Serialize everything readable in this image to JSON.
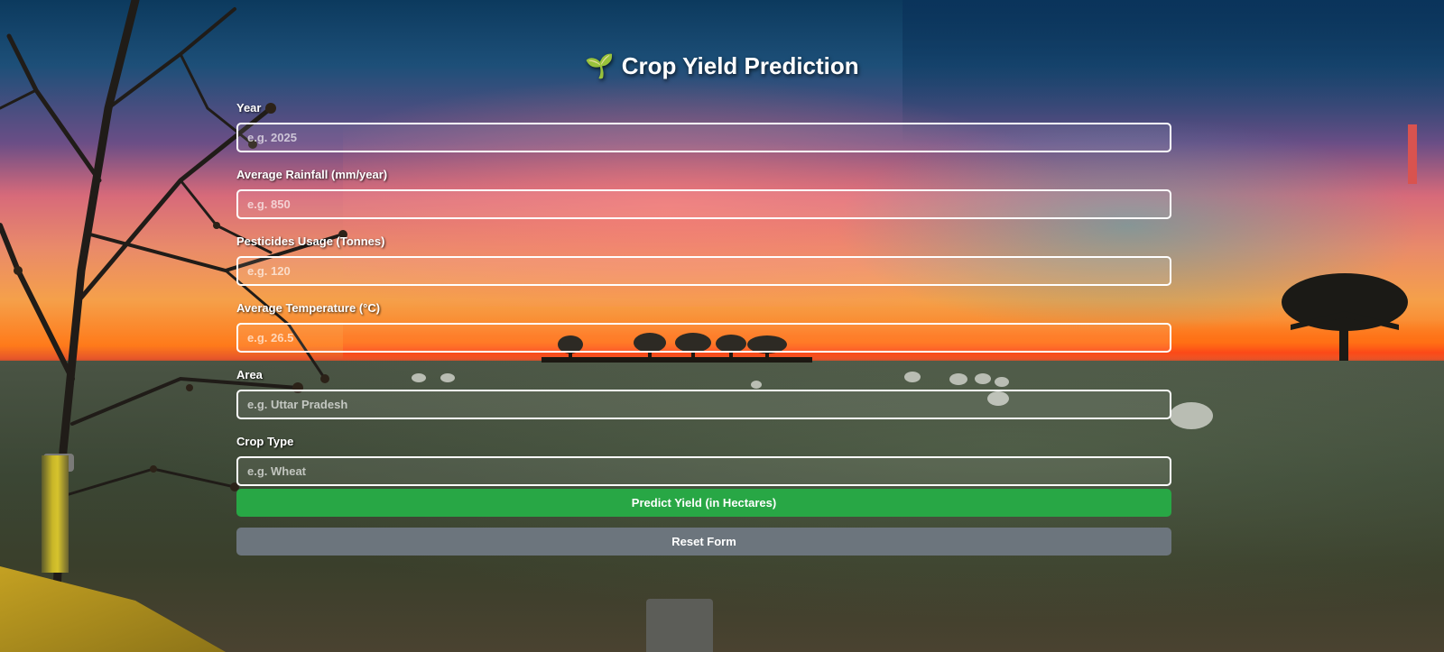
{
  "page": {
    "title": "Crop Yield Prediction",
    "title_icon": "🌱"
  },
  "form": {
    "fields": [
      {
        "label": "Year",
        "placeholder": "e.g. 2025"
      },
      {
        "label": "Average Rainfall (mm/year)",
        "placeholder": "e.g. 850"
      },
      {
        "label": "Pesticides Usage (Tonnes)",
        "placeholder": "e.g. 120"
      },
      {
        "label": "Average Temperature (°C)",
        "placeholder": "e.g. 26.5"
      },
      {
        "label": "Area",
        "placeholder": "e.g. Uttar Pradesh"
      },
      {
        "label": "Crop Type",
        "placeholder": "e.g. Wheat"
      }
    ],
    "predict_label": "Predict Yield (in Hectares)",
    "reset_label": "Reset Form"
  },
  "colors": {
    "predict_button": "#28a745",
    "reset_button": "#6c757d",
    "input_border": "#ffffff"
  }
}
